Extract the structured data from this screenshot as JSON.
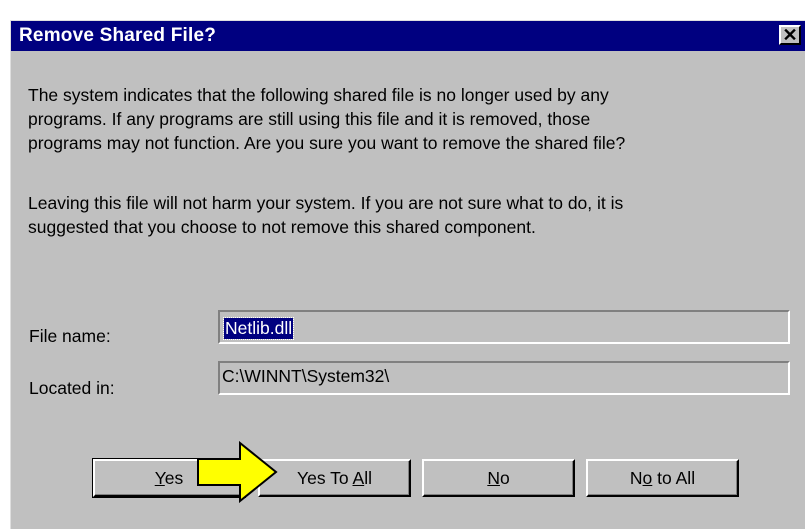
{
  "dialog": {
    "title": "Remove Shared File?",
    "close_glyph": "✕",
    "message1": {
      "line1": "The system indicates that the following shared file is no longer used by any",
      "line2": "programs.  If any programs are still using this file and it is removed, those",
      "line3": "programs may not function.  Are you sure you want to remove the shared file?"
    },
    "message2": {
      "line1": "Leaving this file will not harm your system.  If you are not sure what to do, it is",
      "line2": "suggested that you choose to not remove this shared component."
    },
    "file_name": {
      "label": "File name:",
      "value": "Netlib.dll"
    },
    "located_in": {
      "label": "Located in:",
      "value": "C:\\WINNT\\System32\\"
    },
    "buttons": {
      "yes": {
        "pre": "",
        "key": "Y",
        "post": "es"
      },
      "yes_to_all": {
        "pre": "Yes To ",
        "key": "A",
        "post": "ll"
      },
      "no": {
        "pre": "",
        "key": "N",
        "post": "o"
      },
      "no_to_all": {
        "pre": "N",
        "key": "o",
        "post": " to All"
      }
    }
  },
  "colors": {
    "titlebar": "#000080",
    "dialog_face": "#c0c0c0",
    "highlight_arrow": "#ffff00"
  },
  "icons": {
    "pointer": "arrow-pointer-icon",
    "close": "close-icon"
  }
}
